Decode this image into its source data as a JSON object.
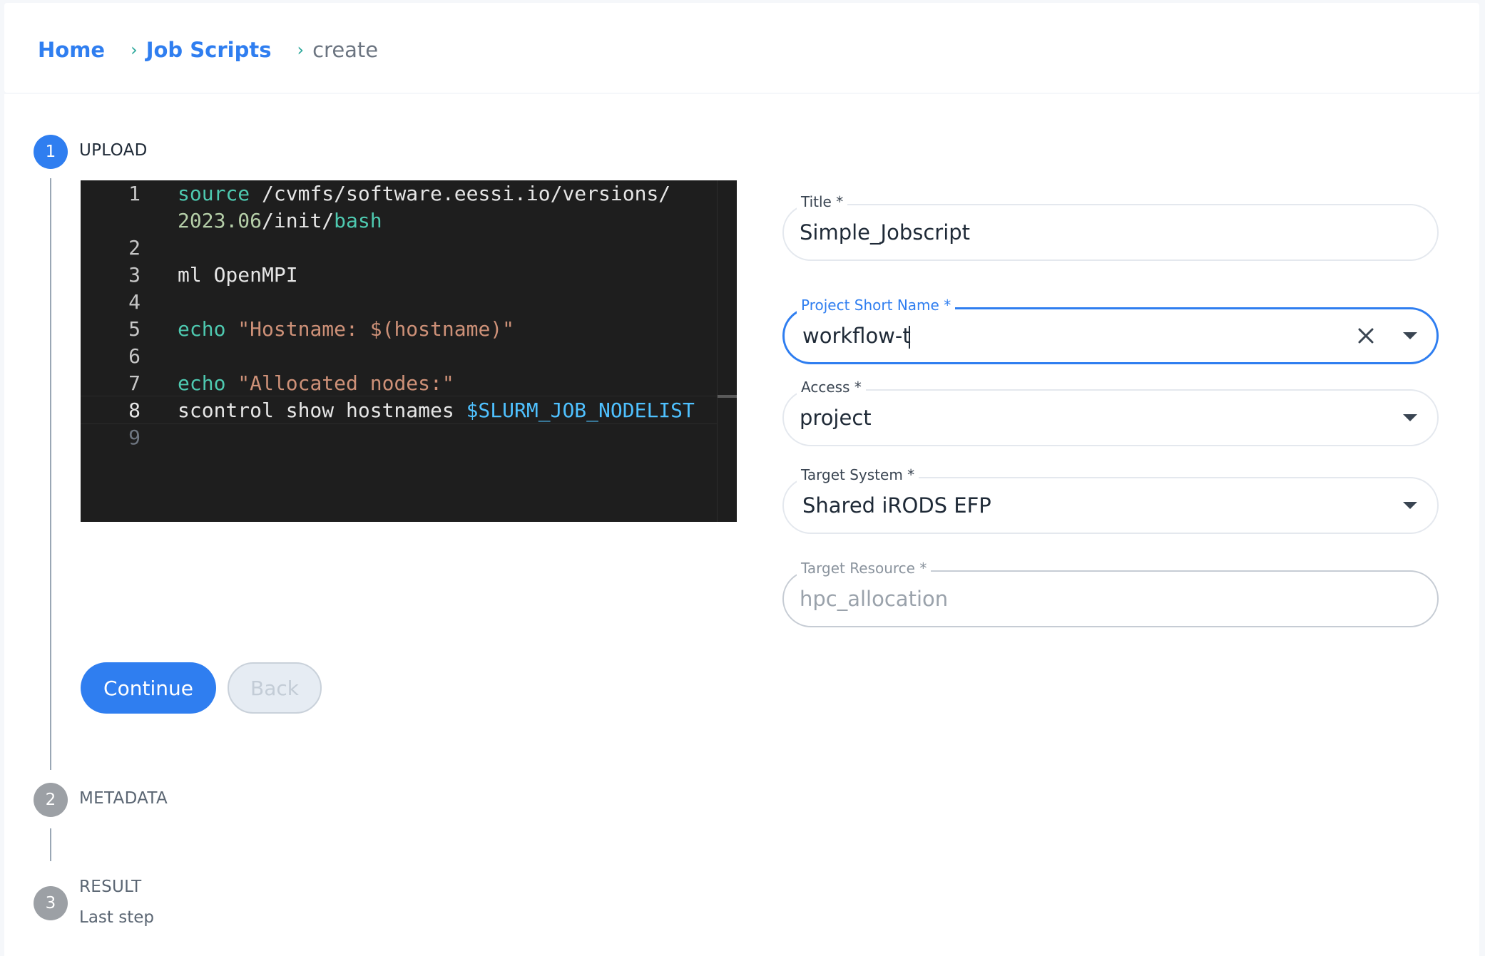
{
  "breadcrumb": {
    "home": "Home",
    "job_scripts": "Job Scripts",
    "current": "create",
    "separator": "›"
  },
  "steps": [
    {
      "number": "1",
      "label": "UPLOAD",
      "subtitle": ""
    },
    {
      "number": "2",
      "label": "METADATA",
      "subtitle": ""
    },
    {
      "number": "3",
      "label": "RESULT",
      "subtitle": "Last step"
    }
  ],
  "editor": {
    "line_numbers": [
      "1",
      "2",
      "3",
      "4",
      "5",
      "6",
      "7",
      "8",
      "9"
    ],
    "lines": {
      "l1a_kw": "source",
      "l1a_rest": " /cvmfs/software.eessi.io/versions/",
      "l1b_num": "2023.06",
      "l1b_mid": "/init/",
      "l1b_kw": "bash",
      "l3": "ml OpenMPI",
      "l5_kw": "echo",
      "l5_str": " \"Hostname: $(hostname)\"",
      "l7_kw": "echo",
      "l7_str": " \"Allocated nodes:\"",
      "l8_plain": "scontrol show hostnames ",
      "l8_var": "$SLURM_JOB_NODELIST"
    },
    "active_line": 8
  },
  "form": {
    "title": {
      "label": "Title",
      "required": "*",
      "value": "Simple_Jobscript"
    },
    "project_short_name": {
      "label": "Project Short Name",
      "required": "*",
      "value": "workflow-t"
    },
    "access": {
      "label": "Access",
      "required": "*",
      "value": "project"
    },
    "target_system": {
      "label": "Target System",
      "required": "*",
      "value": "Shared iRODS EFP"
    },
    "target_resource": {
      "label": "Target Resource",
      "required": "*",
      "value": "hpc_allocation"
    }
  },
  "buttons": {
    "continue": "Continue",
    "back": "Back"
  },
  "colors": {
    "accent": "#2f7ef0",
    "step_inactive": "#9ca0a5",
    "editor_bg": "#1e1e1e",
    "keyword": "#4ec9b0",
    "string": "#ce9178",
    "number": "#b5cea8",
    "variable": "#4fc1ff"
  },
  "icons": {
    "clear": "close-icon",
    "dropdown": "chevron-down-icon"
  }
}
